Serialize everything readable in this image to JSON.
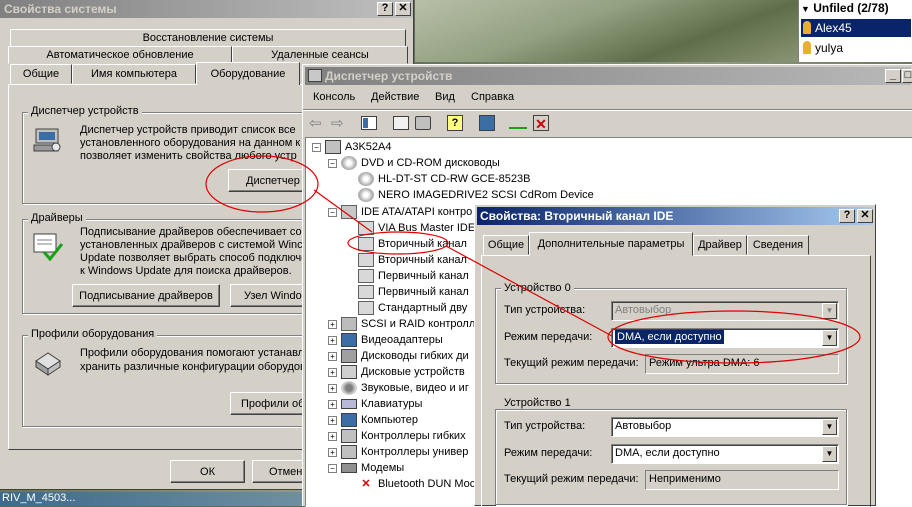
{
  "sysprops": {
    "title": "Свойства системы",
    "tabs_row1": [
      "Восстановление системы"
    ],
    "tabs_row2": [
      "Автоматическое обновление",
      "Удаленные сеансы"
    ],
    "tabs_row3": [
      "Общие",
      "Имя компьютера",
      "Оборудование"
    ],
    "devmgr_group": "Диспетчер устройств",
    "devmgr_text": [
      "Диспетчер устройств приводит список все",
      "установленного оборудования на данном к",
      "позволяет изменить свойства любого устр"
    ],
    "devmgr_button": "Диспетчер",
    "drivers_group": "Драйверы",
    "drivers_text": [
      "Подписывание драйверов обеспечивает со",
      "установленных драйверов с системой Winc",
      "Update позволяет выбрать способ подключе",
      "к Windows Update для поиска драйверов."
    ],
    "drivers_sign_button": "Подписывание драйверов",
    "windows_update_button": "Узел Windo",
    "profiles_group": "Профили оборудования",
    "profiles_text": [
      "Профили оборудования помогают устанавл",
      "хранить различные конфигурации оборудов"
    ],
    "profiles_button": "Профили об",
    "ok": "ОК",
    "cancel": "Отмен"
  },
  "userlist": {
    "header": "Unfiled (2/78)",
    "users": [
      "Alex45",
      "yulya"
    ]
  },
  "taskbar_text": "RIV_M_4503...",
  "devmgr": {
    "title": "Диспетчер устройств",
    "menu": [
      "Консоль",
      "Действие",
      "Вид",
      "Справка"
    ],
    "tree": {
      "root": "A3K52A4",
      "dvd": "DVD и CD-ROM дисководы",
      "dvd_items": [
        "HL-DT-ST CD-RW GCE-8523B",
        "NERO IMAGEDRIVE2 SCSI CdRom Device"
      ],
      "ide": "IDE ATA/ATAPI контро",
      "ide_items": [
        "VIA Bus Master IDE",
        "Вторичный канал",
        "Вторичный канал",
        "Первичный канал",
        "Первичный канал",
        "Стандартный дву"
      ],
      "categories": [
        "SCSI и RAID контролл",
        "Видеоадаптеры",
        "Дисководы гибких ди",
        "Дисковые устройств",
        "Звуковые, видео и иг",
        "Клавиатуры",
        "Компьютер",
        "Контроллеры гибких",
        "Контроллеры универ",
        "Модемы"
      ],
      "modem_item": "Bluetooth DUN Moc"
    }
  },
  "ideprops": {
    "title": "Свойства: Вторичный канал IDE",
    "tabs": [
      "Общие",
      "Дополнительные параметры",
      "Драйвер",
      "Сведения"
    ],
    "device0": {
      "label": "Устройство 0",
      "type_label": "Тип устройства:",
      "type_value": "Автовыбор",
      "mode_label": "Режим передачи:",
      "mode_value": "DMA, если доступно",
      "current_label": "Текущий режим передачи:",
      "current_value": "Режим ультра DMA: 6"
    },
    "device1": {
      "label": "Устройство 1",
      "type_label": "Тип устройства:",
      "type_value": "Автовыбор",
      "mode_label": "Режим передачи:",
      "mode_value": "DMA, если доступно",
      "current_label": "Текущий режим передачи:",
      "current_value": "Неприменимо"
    }
  },
  "colors": {
    "titlebar_active": "#0a246a",
    "titlebar_inactive": "#808080",
    "window_bg": "#d4d0c8",
    "annotation": "#e00000",
    "selection": "#0a246a"
  }
}
